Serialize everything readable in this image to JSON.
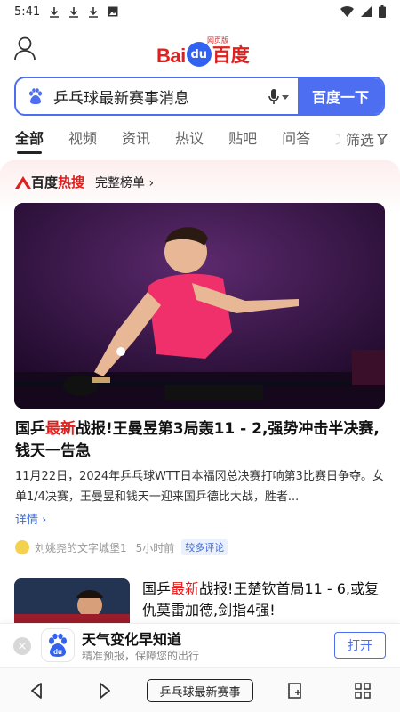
{
  "status_bar": {
    "time": "5:41",
    "icons": [
      "download-icon",
      "download-icon",
      "download-icon",
      "gallery-icon"
    ],
    "right_icons": [
      "wifi-icon",
      "signal-icon",
      "battery-icon"
    ]
  },
  "header": {
    "logo_bai": "Bai",
    "logo_du": "du",
    "logo_cn": "百度",
    "logo_small": "网页版"
  },
  "search": {
    "query": "乒乓球最新赛事消息",
    "button_label": "百度一下"
  },
  "tabs": {
    "items": [
      "全部",
      "视频",
      "资讯",
      "热议",
      "贴吧",
      "问答",
      "文"
    ],
    "active": "全部",
    "filter_label": "筛选"
  },
  "hot": {
    "brand": "百度",
    "brand_red": "热搜",
    "more_label": "完整榜单 ›"
  },
  "news": {
    "title_prefix": "国乒",
    "title_highlight": "最新",
    "title_rest": "战报!王曼昱第3局轰11 - 2,强势冲击半决赛,钱天一告急",
    "desc": "11月22日，2024年乒乓球WTT日本福冈总决赛打响第3比赛日争夺。女单1/4决赛，王曼昱和钱天一迎来国乒德比大战，胜者...",
    "detail_label": "详情 ›",
    "source": "刘姚尧的文字城堡1",
    "time": "5小时前",
    "tag": "较多评论"
  },
  "news2": {
    "title_prefix": "国乒",
    "title_highlight": "最新",
    "title_rest": "战报!王楚钦首局11 - 6,或复仇莫雷加德,剑指4强!"
  },
  "ad": {
    "close": "×",
    "title": "天气变化早知道",
    "subtitle": "精准预报，保障您的出行",
    "button": "打开",
    "logo_text": "du"
  },
  "bottom_nav": {
    "query": "乒乓球最新赛事"
  },
  "colors": {
    "brand_blue": "#4e6ef2",
    "brand_red": "#e0201e"
  }
}
